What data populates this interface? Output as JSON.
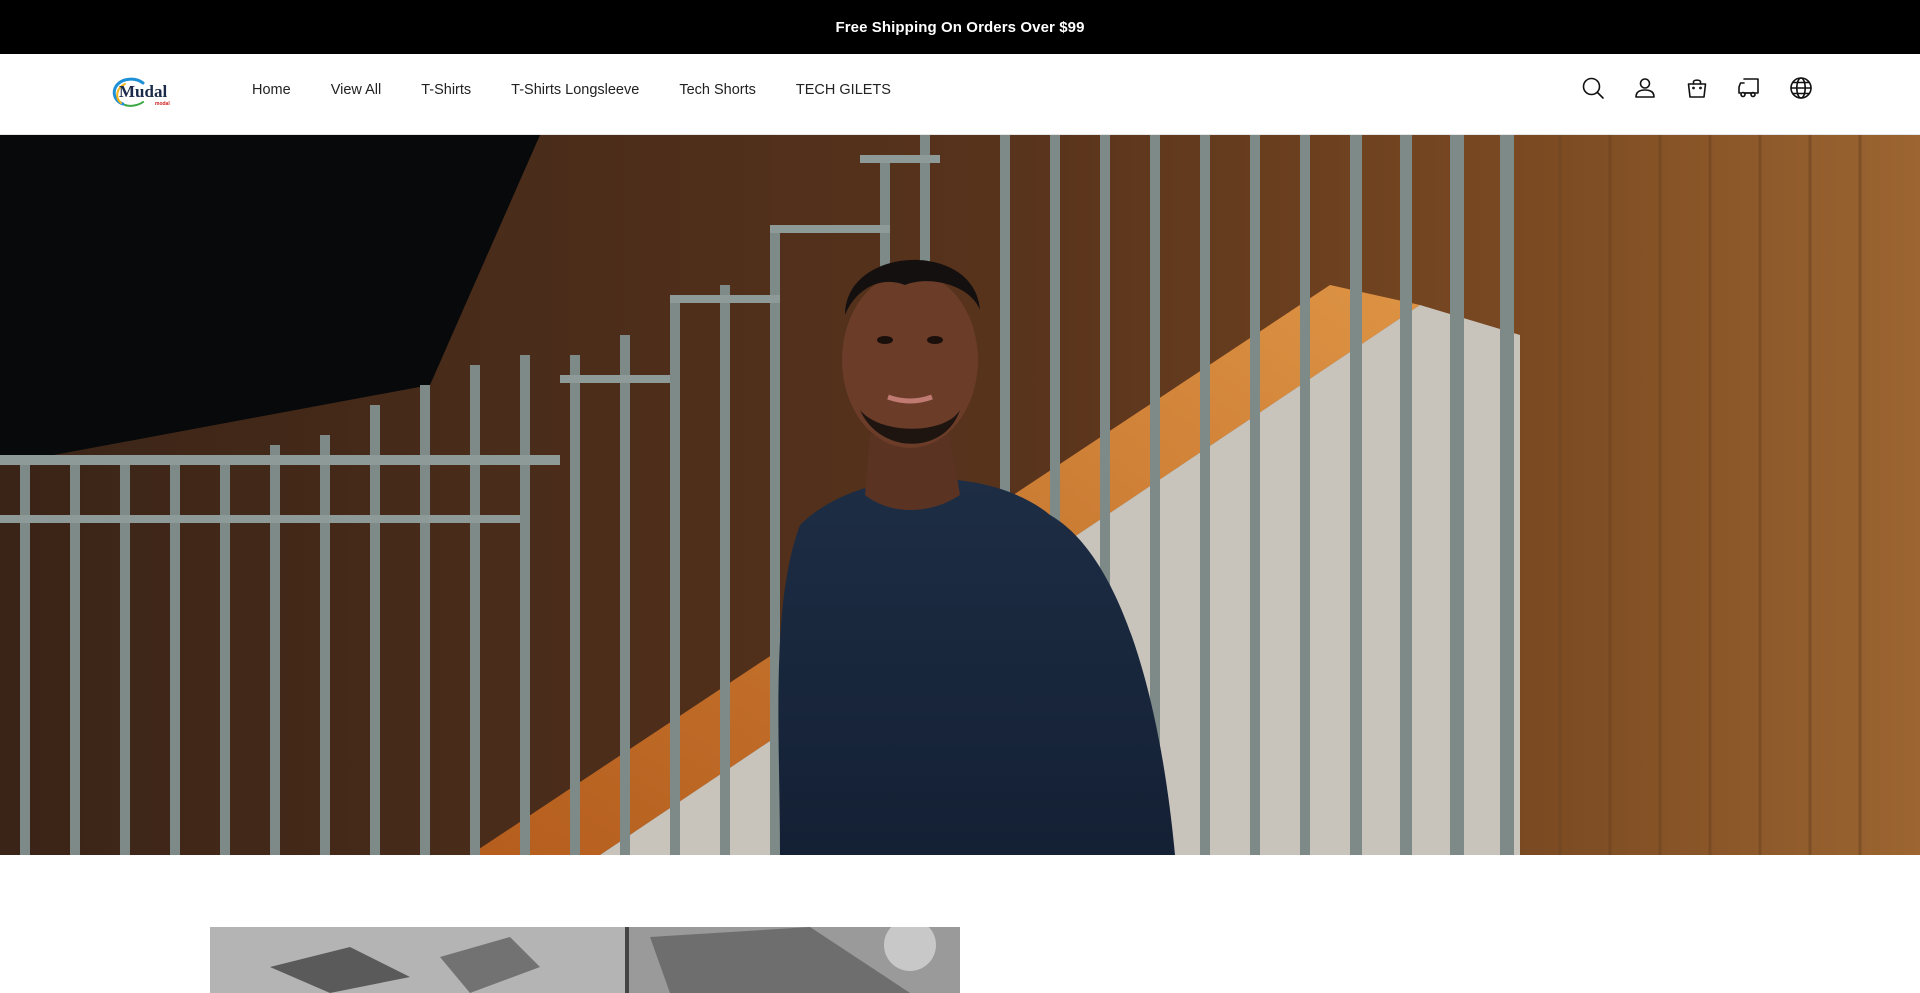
{
  "announcement": {
    "text": "Free Shipping On Orders Over $99"
  },
  "brand": {
    "name": "Mudal",
    "sub": "modal",
    "accent": "#1e90d6"
  },
  "nav": {
    "items": [
      {
        "label": "Home"
      },
      {
        "label": "View All"
      },
      {
        "label": "T-Shirts"
      },
      {
        "label": "T-Shirts Longsleeve"
      },
      {
        "label": "Tech Shorts"
      },
      {
        "label": "TECH GILETS"
      }
    ]
  },
  "header_icons": [
    "search-icon",
    "account-icon",
    "cart-icon",
    "delivery-icon",
    "globe-icon"
  ],
  "colors": {
    "announcement_bg": "#000000",
    "text": "#222222"
  }
}
